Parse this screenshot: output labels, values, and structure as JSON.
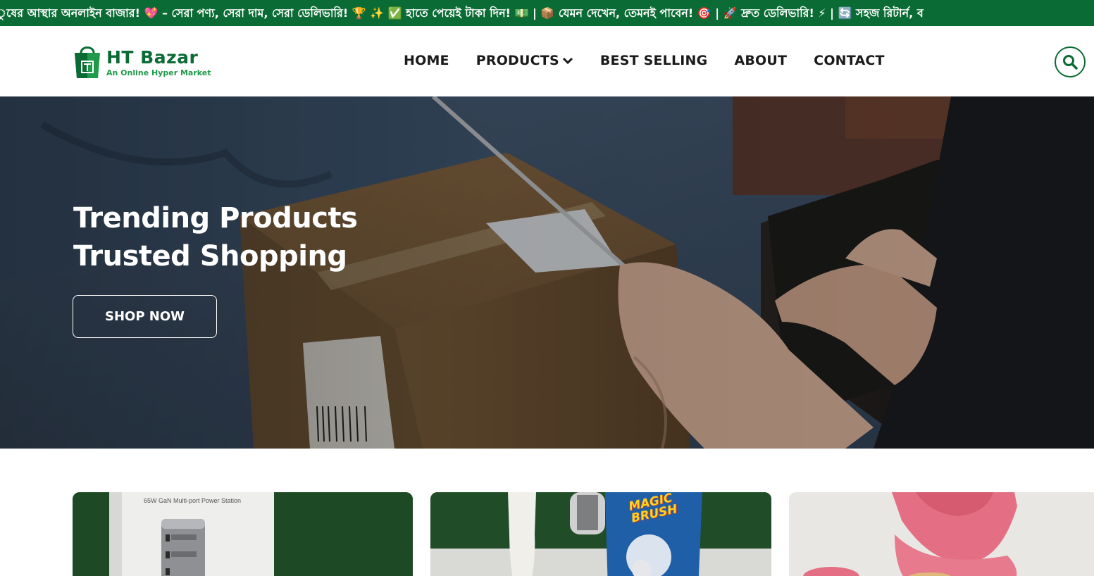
{
  "announcement": {
    "text": "ুষের আস্থার অনলাইন বাজার! 💖 – সেরা পণ্য, সেরা দাম, সেরা ডেলিভারি! 🏆 ✨ ✅ হাতে পেয়েই টাকা দিন! 💵 | 📦 যেমন দেখেন, তেমনই পাবেন! 🎯 | 🚀 দ্রুত ডেলিভারি! ⚡ | 🔄 সহজ রিটার্ন, ব"
  },
  "header": {
    "logo_name": "HT Bazar",
    "logo_tagline": "An Online Hyper Market",
    "nav": {
      "home": "HOME",
      "products": "PRODUCTS",
      "best_selling": "BEST SELLING",
      "about": "ABOUT",
      "contact": "CONTACT"
    },
    "search_icon": "search-icon",
    "brand_color": "#0b6b34"
  },
  "hero": {
    "title_line1": "Trending Products",
    "title_line2": "Trusted Shopping",
    "cta_label": "SHOP NOW"
  },
  "products": {
    "card1_caption": "65W GaN Multi-port Power Station",
    "card2_brand_line1": "MAGIC",
    "card2_brand_line2": "BRUSH"
  }
}
